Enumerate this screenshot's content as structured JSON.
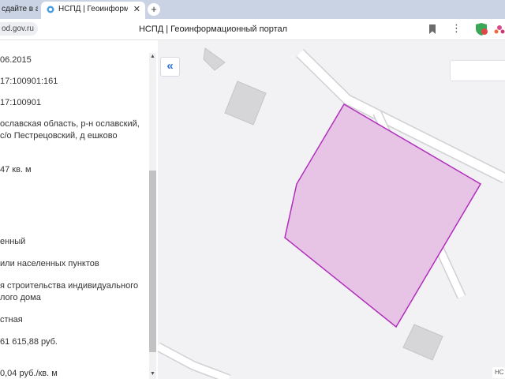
{
  "browser": {
    "tabs": [
      {
        "label": "сдайте в а",
        "active": false
      },
      {
        "label": "НСПД | Геоинформацио",
        "active": true
      }
    ],
    "close_tab_glyph": "✕",
    "new_tab_glyph": "+",
    "url": "od.gov.ru",
    "page_title": "НСПД | Геоинформационный портал",
    "menu_glyph": "⋮",
    "icons": [
      "favicon-icon",
      "bookmark-icon",
      "menu-icon",
      "protect-icon",
      "extension-icon"
    ]
  },
  "panel": {
    "fields": [
      "06.2015",
      "17:100901:161",
      "17:100901",
      "ославская область, р-н ославский, с/о Пестрецовский, д ешково",
      "47 кв. м",
      "енный",
      "или населенных пунктов",
      "я строительства индивидуального лого дома",
      "стная",
      "61 615,88 руб.",
      "0,04 руб./кв. м"
    ]
  },
  "map": {
    "collapse_glyph": "«",
    "attribution": "НС",
    "parcel_fill": "#e7c4e6",
    "parcel_stroke": "#b12dbc",
    "building_color": "#d6d6d8",
    "road_color": "#ffffff",
    "road_edge_color": "#d0d0d4"
  }
}
